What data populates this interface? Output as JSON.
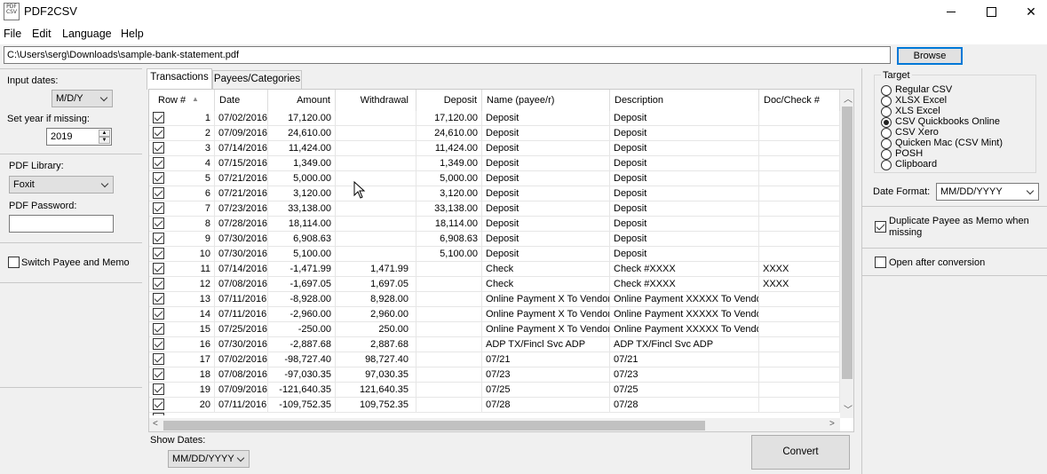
{
  "window": {
    "app_icon_text": "PDF CSV",
    "title": "PDF2CSV"
  },
  "menu": [
    "File",
    "Edit",
    "Language",
    "Help"
  ],
  "file": {
    "path": "C:\\Users\\serg\\Downloads\\sample-bank-statement.pdf",
    "browse_label": "Browse"
  },
  "left": {
    "input_dates_label": "Input dates:",
    "input_dates_value": "M/D/Y",
    "year_label": "Set year if missing:",
    "year_value": "2019",
    "pdf_library_label": "PDF Library:",
    "pdf_library_value": "Foxit",
    "pdf_password_label": "PDF Password:",
    "pdf_password_value": "",
    "switch_payee_label": "Switch Payee and Memo"
  },
  "tabs": [
    "Transactions",
    "Payees/Categories"
  ],
  "grid": {
    "columns": [
      "Row #",
      "Date",
      "Amount",
      "Withdrawal",
      "Deposit",
      "Name (payee/r)",
      "Description",
      "Doc/Check #"
    ],
    "rows": [
      [
        "1",
        "07/02/2016",
        "17,120.00",
        "",
        "17,120.00",
        "Deposit",
        "Deposit",
        ""
      ],
      [
        "2",
        "07/09/2016",
        "24,610.00",
        "",
        "24,610.00",
        "Deposit",
        "Deposit",
        ""
      ],
      [
        "3",
        "07/14/2016",
        "11,424.00",
        "",
        "11,424.00",
        "Deposit",
        "Deposit",
        ""
      ],
      [
        "4",
        "07/15/2016",
        "1,349.00",
        "",
        "1,349.00",
        "Deposit",
        "Deposit",
        ""
      ],
      [
        "5",
        "07/21/2016",
        "5,000.00",
        "",
        "5,000.00",
        "Deposit",
        "Deposit",
        ""
      ],
      [
        "6",
        "07/21/2016",
        "3,120.00",
        "",
        "3,120.00",
        "Deposit",
        "Deposit",
        ""
      ],
      [
        "7",
        "07/23/2016",
        "33,138.00",
        "",
        "33,138.00",
        "Deposit",
        "Deposit",
        ""
      ],
      [
        "8",
        "07/28/2016",
        "18,114.00",
        "",
        "18,114.00",
        "Deposit",
        "Deposit",
        ""
      ],
      [
        "9",
        "07/30/2016",
        "6,908.63",
        "",
        "6,908.63",
        "Deposit",
        "Deposit",
        ""
      ],
      [
        "10",
        "07/30/2016",
        "5,100.00",
        "",
        "5,100.00",
        "Deposit",
        "Deposit",
        ""
      ],
      [
        "11",
        "07/14/2016",
        "-1,471.99",
        "1,471.99",
        "",
        "Check",
        "Check #XXXX",
        "XXXX"
      ],
      [
        "12",
        "07/08/2016",
        "-1,697.05",
        "1,697.05",
        "",
        "Check",
        "Check #XXXX",
        "XXXX"
      ],
      [
        "13",
        "07/11/2016",
        "-8,928.00",
        "8,928.00",
        "",
        "Online Payment X To Vendor",
        "Online Payment XXXXX To Vendor",
        ""
      ],
      [
        "14",
        "07/11/2016",
        "-2,960.00",
        "2,960.00",
        "",
        "Online Payment X To Vendor",
        "Online Payment XXXXX To Vendor",
        ""
      ],
      [
        "15",
        "07/25/2016",
        "-250.00",
        "250.00",
        "",
        "Online Payment X To Vendor",
        "Online Payment XXXXX To Vendor",
        ""
      ],
      [
        "16",
        "07/30/2016",
        "-2,887.68",
        "2,887.68",
        "",
        "ADP TX/Fincl Svc ADP",
        "ADP TX/Fincl Svc ADP",
        ""
      ],
      [
        "17",
        "07/02/2016",
        "-98,727.40",
        "98,727.40",
        "",
        "07/21",
        "07/21",
        ""
      ],
      [
        "18",
        "07/08/2016",
        "-97,030.35",
        "97,030.35",
        "",
        "07/23",
        "07/23",
        ""
      ],
      [
        "19",
        "07/09/2016",
        "-121,640.35",
        "121,640.35",
        "",
        "07/25",
        "07/25",
        ""
      ],
      [
        "20",
        "07/11/2016",
        "-109,752.35",
        "109,752.35",
        "",
        "07/28",
        "07/28",
        ""
      ]
    ]
  },
  "show_dates": {
    "label": "Show Dates:",
    "value": "MM/DD/YYYY"
  },
  "convert_label": "Convert",
  "right": {
    "target_label": "Target",
    "targets": [
      "Regular CSV",
      "XLSX Excel",
      "XLS Excel",
      "CSV Quickbooks Online",
      "CSV Xero",
      "Quicken Mac (CSV Mint)",
      "POSH",
      "Clipboard"
    ],
    "selected_target": "CSV Quickbooks Online",
    "date_format_label": "Date Format:",
    "date_format_value": "MM/DD/YYYY",
    "duplicate_payee_label": "Duplicate Payee as Memo when missing",
    "open_after_label": "Open after conversion"
  }
}
